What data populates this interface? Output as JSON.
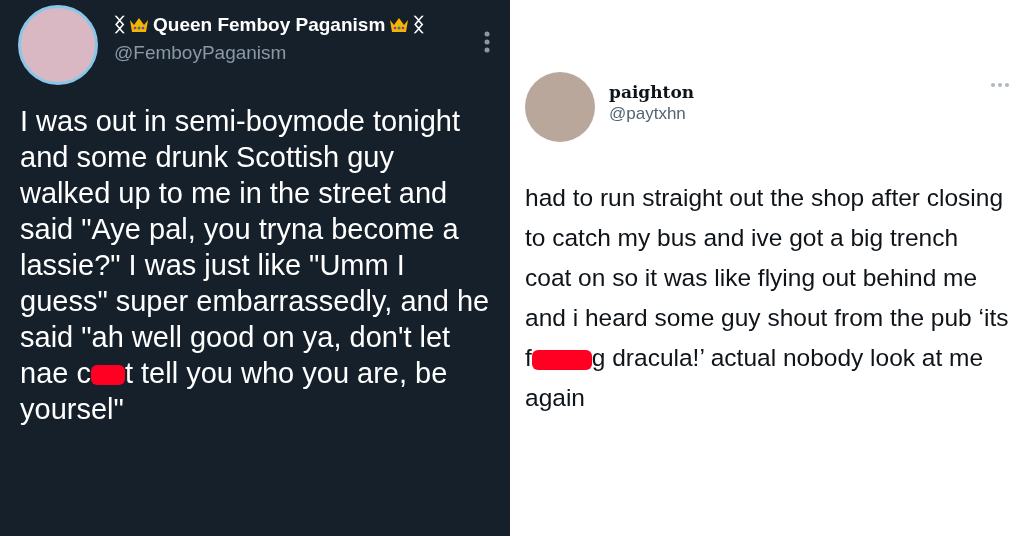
{
  "tweets": [
    {
      "kind": "dark",
      "name_prefix": "ᛝ",
      "name": "Queen Femboy Paganism",
      "name_suffix": "ᛝ",
      "handle": "@FemboyPaganism",
      "body": [
        {
          "kind": "text",
          "text": "I was out in semi-boymode tonight and some drunk Scottish guy walked up to me in the street and said \"Aye pal, you tryna become a lassie?\" I was just like \"Umm I guess\" super embarrassedly, and he said \"ah well good on ya, don't let nae c"
        },
        {
          "kind": "redaction"
        },
        {
          "kind": "text",
          "text": "t tell you who you are, be yoursel\""
        }
      ]
    },
    {
      "kind": "light",
      "name": "paighton",
      "handle": "@paytxhn",
      "body": [
        {
          "kind": "text",
          "text": "had to run straight out the shop after closing to catch my bus and ive got a big trench coat on so it was like flying out behind me and i heard some guy shout from the pub ‘its f"
        },
        {
          "kind": "redaction"
        },
        {
          "kind": "text",
          "text": "g dracula!’ actual nobody look at me again"
        }
      ]
    }
  ]
}
